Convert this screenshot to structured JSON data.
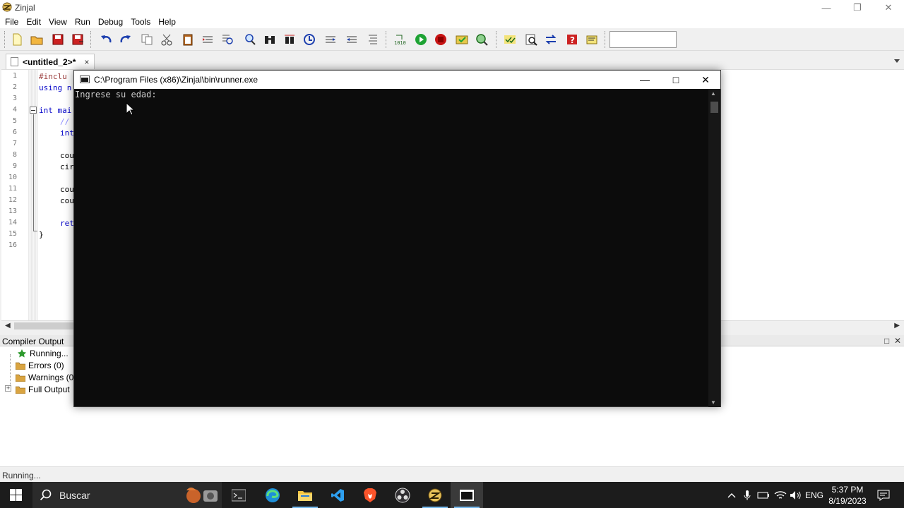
{
  "window": {
    "title": "Zinjal"
  },
  "menu": [
    "File",
    "Edit",
    "View",
    "Run",
    "Debug",
    "Tools",
    "Help"
  ],
  "toolbar": {
    "icons": [
      "new-file-icon",
      "open-folder-icon",
      "save-icon",
      "save-as-icon",
      "undo-icon",
      "redo-icon",
      "copy-icon",
      "cut-icon",
      "paste-icon",
      "indent-icon",
      "find-icon",
      "find-next-icon",
      "binoculars-icon",
      "replace-icon",
      "goto-icon",
      "comment-icon",
      "uncomment-icon",
      "format-icon",
      "compile-icon",
      "run-icon",
      "stop-icon",
      "debug-icon",
      "inspect-icon",
      "checklist-icon",
      "search-help-icon",
      "swap-icon",
      "help-icon",
      "notes-icon"
    ],
    "search_value": ""
  },
  "tab": {
    "label": "<untitled_2>*",
    "close": "×"
  },
  "editor": {
    "line_numbers": [
      "1",
      "2",
      "3",
      "4",
      "5",
      "6",
      "7",
      "8",
      "9",
      "10",
      "11",
      "12",
      "13",
      "14",
      "15",
      "16"
    ],
    "lines": [
      "#inclu",
      "using n",
      "",
      "int mai",
      "//",
      "int",
      "",
      "cou",
      "cir",
      "",
      "cou",
      "cou",
      "",
      "ret",
      "}",
      ""
    ]
  },
  "compiler_output": {
    "title": "Compiler Output",
    "items": [
      {
        "label": "Running...",
        "icon": "star-icon"
      },
      {
        "label": "Errors (0)",
        "icon": "folder-icon"
      },
      {
        "label": "Warnings (0)",
        "icon": "folder-icon"
      },
      {
        "label": "Full Output",
        "icon": "folder-icon"
      }
    ],
    "expander": "+"
  },
  "status": {
    "text": "Running..."
  },
  "console": {
    "title": "C:\\Program Files (x86)\\Zinjal\\bin\\runner.exe",
    "output": "Ingrese su edad:"
  },
  "taskbar": {
    "search_label": "Buscar",
    "language": "ENG",
    "time": "5:37 PM",
    "date": "8/19/2023"
  },
  "colors": {
    "console_bg": "#0c0c0c",
    "console_text": "#cccccc",
    "taskbar_bg": "#1c1c1c",
    "keyword": "#0000c8"
  }
}
